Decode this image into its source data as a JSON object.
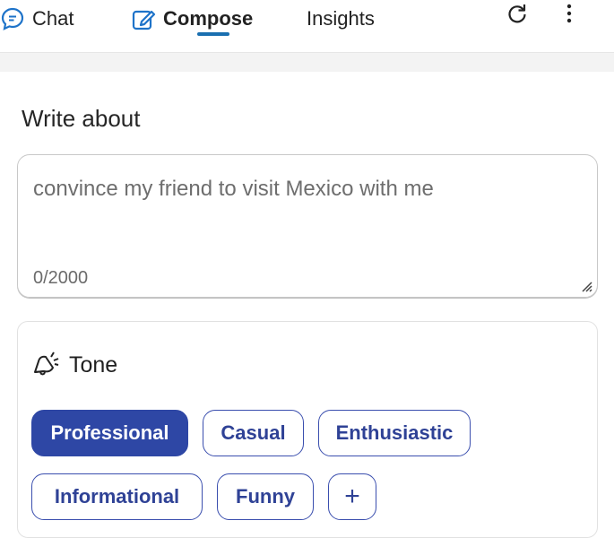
{
  "tabs": [
    {
      "label": "Chat",
      "icon": "chat-bubble-icon"
    },
    {
      "label": "Compose",
      "icon": "compose-edit-icon",
      "active": true
    },
    {
      "label": "Insights"
    }
  ],
  "toolbar": {
    "refresh_icon": "refresh-icon",
    "more_icon": "more-vertical-icon"
  },
  "compose": {
    "write_about_label": "Write about",
    "placeholder": "convince my friend to visit Mexico with me",
    "counter": "0/2000"
  },
  "tone": {
    "label": "Tone",
    "icon": "megaphone-icon",
    "options": [
      "Professional",
      "Casual",
      "Enthusiastic",
      "Informational",
      "Funny"
    ],
    "selected": "Professional",
    "add_label": "+"
  },
  "colors": {
    "accent": "#2e47a5",
    "tab_underline": "#1a6fb0",
    "icon_blue": "#1e73c9"
  }
}
